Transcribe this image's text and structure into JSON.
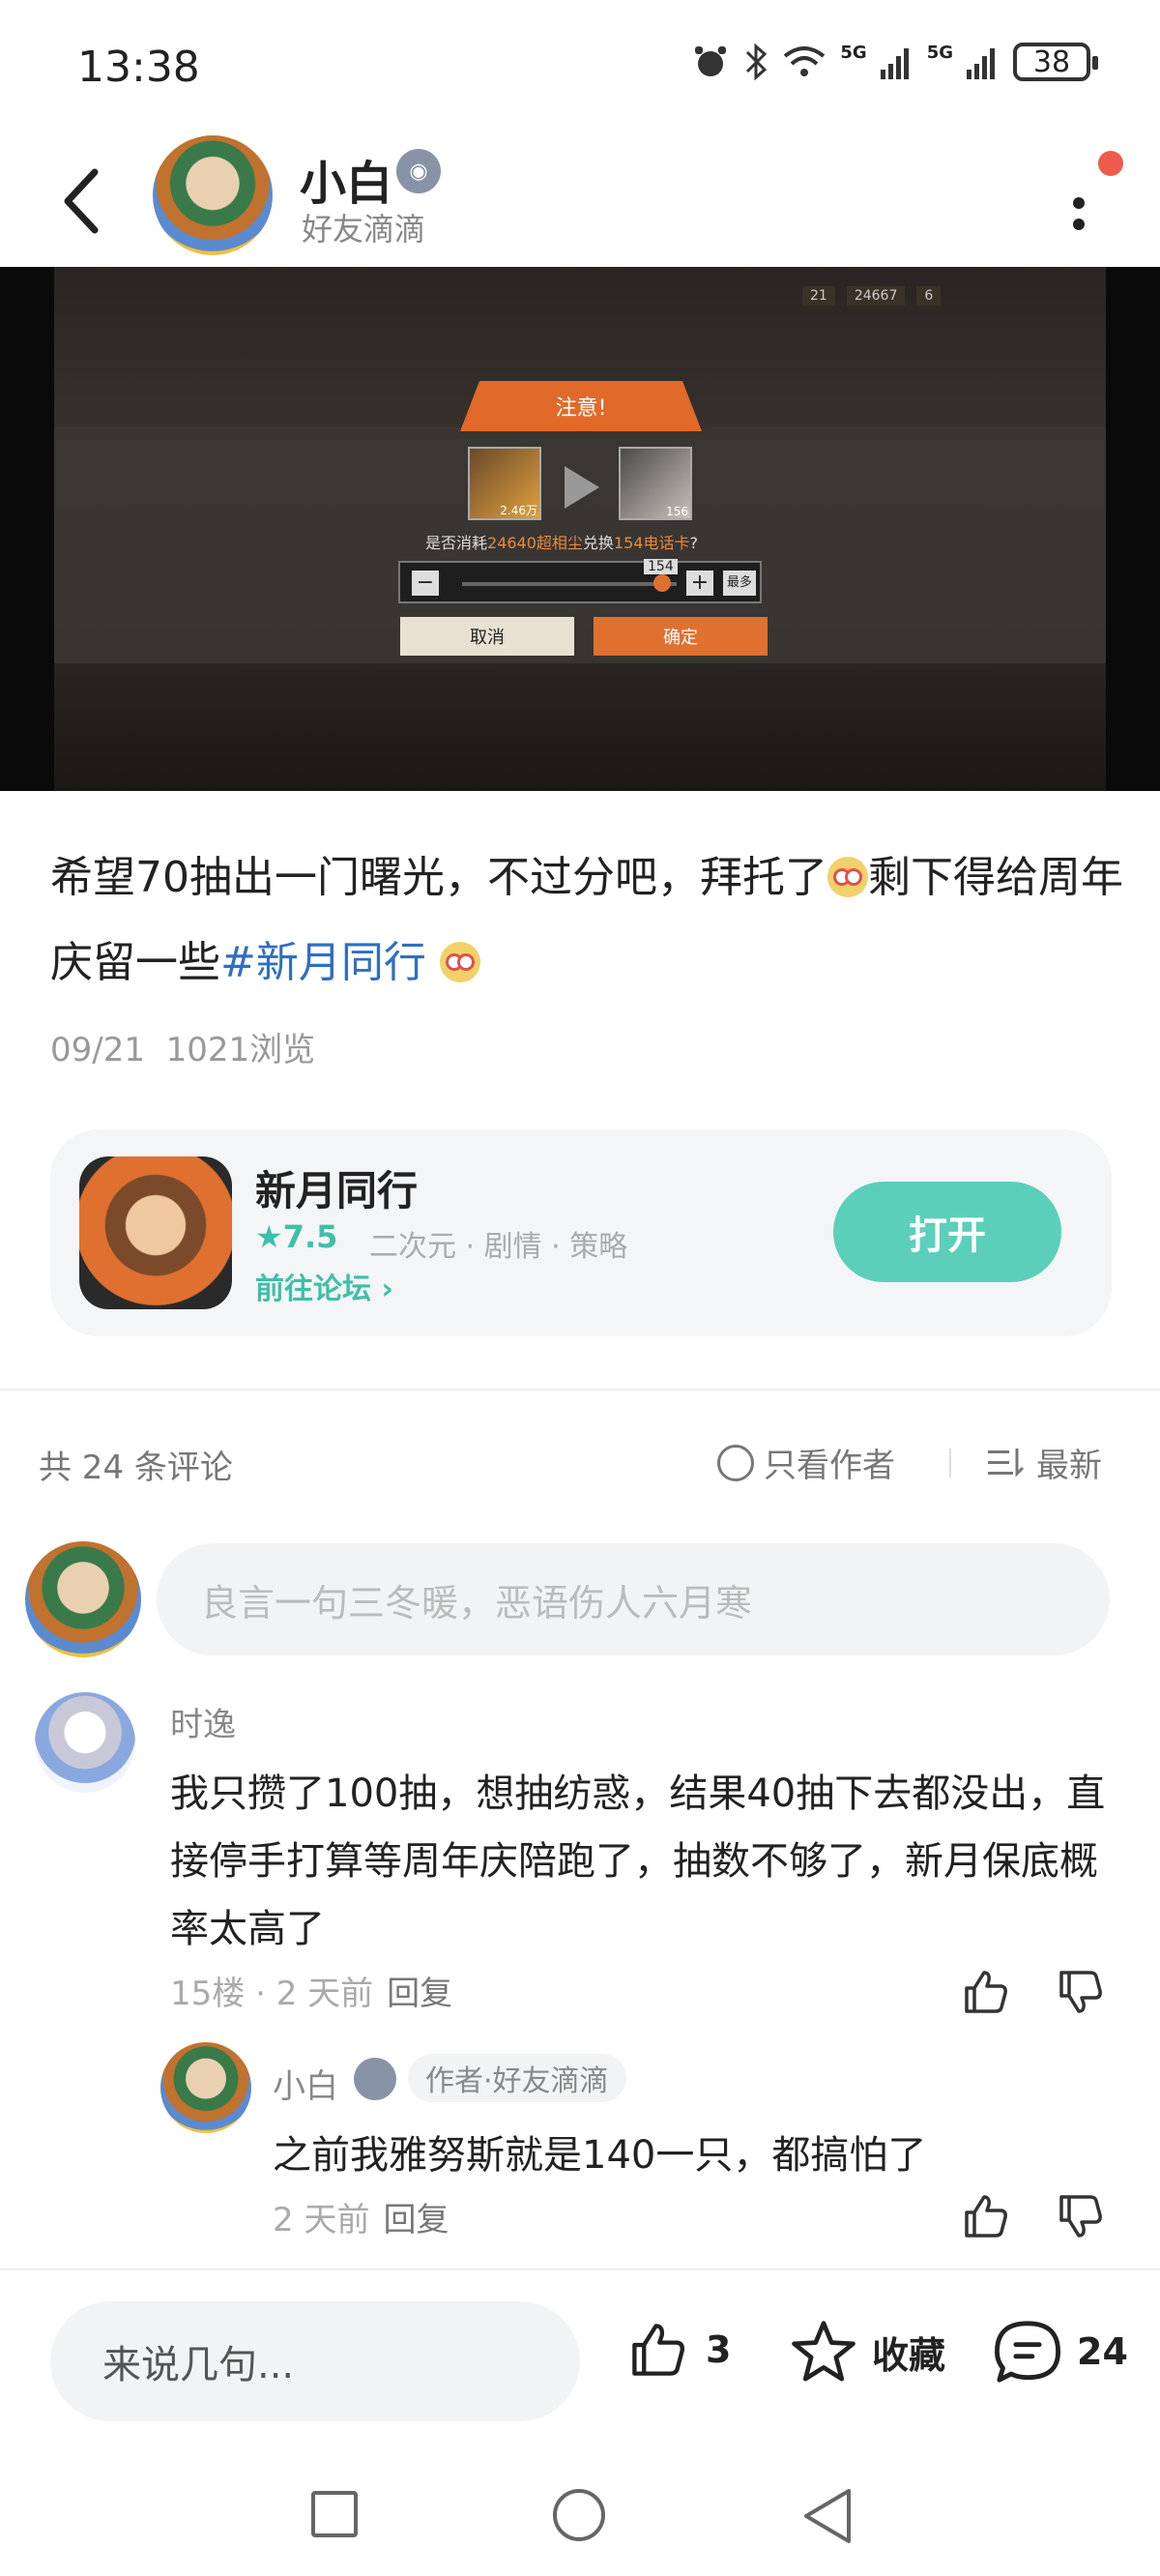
{
  "status_bar": {
    "time": "13:38",
    "battery": "38",
    "signal1": "5G",
    "signal2": "5G"
  },
  "header": {
    "username": "小白",
    "subtitle": "好友滴滴"
  },
  "media": {
    "dialog_title": "注意!",
    "item1_count": "2.46万",
    "item2_count": "156",
    "prompt_prefix": "是否消耗",
    "prompt_amount": "24640超相尘",
    "prompt_mid": "兑换",
    "prompt_target": "154电话卡",
    "prompt_suffix": "?",
    "slider_value": "154",
    "max_label": "最多",
    "cancel_label": "取消",
    "confirm_label": "确定",
    "hud_val1": "21",
    "hud_val2": "24667",
    "hud_val3": "6"
  },
  "post": {
    "text_part1": "希望70抽出一门曙光，不过分吧，拜托了",
    "text_part2": "剩下得给周年庆留一些",
    "hashtag": "#新月同行",
    "date": "09/21",
    "views": "1021浏览"
  },
  "game_card": {
    "name": "新月同行",
    "rating": "★7.5",
    "tags": "二次元 · 剧情 · 策略",
    "forum_link": "前往论坛 ›",
    "open_label": "打开"
  },
  "comments_section": {
    "count_label": "共 24 条评论",
    "only_author": "只看作者",
    "sort_label": "最新",
    "input_placeholder": "良言一句三冬暖，恶语伤人六月寒"
  },
  "comments": [
    {
      "name": "时逸",
      "text": "我只攒了100抽，想抽纺惑，结果40抽下去都没出，直接停手打算等周年庆陪跑了，抽数不够了，新月保底概率太高了",
      "floor": "15楼",
      "time": "2 天前",
      "reply_label": "回复"
    }
  ],
  "reply": {
    "name": "小白",
    "tag": "作者·好友滴滴",
    "text": "之前我雅努斯就是140一只，都搞怕了",
    "time": "2 天前",
    "reply_label": "回复"
  },
  "bottom_bar": {
    "input_placeholder": "来说几句...",
    "like_count": "3",
    "collect_label": "收藏",
    "comment_count": "24"
  },
  "colors": {
    "accent": "#5ccfbb",
    "hashtag": "#2f6fc1",
    "notification": "#f05a4a"
  }
}
